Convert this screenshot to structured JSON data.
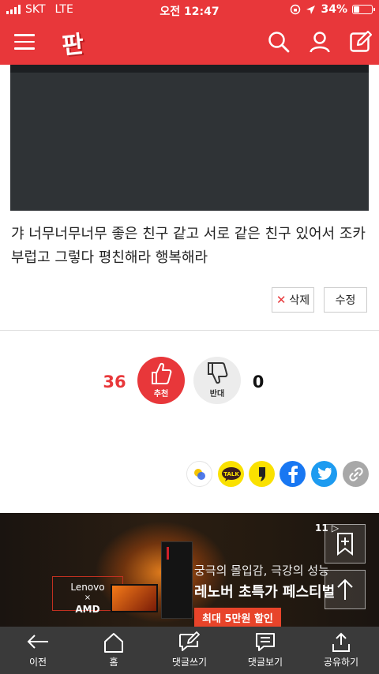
{
  "status_bar": {
    "carrier": "SKT",
    "network": "LTE",
    "time": "오전 12:47",
    "battery_text": "34%",
    "battery_level": 0.34
  },
  "header": {
    "logo_text": "판",
    "icons": [
      "menu-icon",
      "search-icon",
      "user-icon",
      "write-icon"
    ],
    "color": "#e8373a"
  },
  "comment": {
    "text": "갸 너무너무너무 좋은 친구 같고 서로 같은 친구 있어서 조카 부럽고 그렇다 평친해라 행복해라",
    "delete_label": "삭제",
    "edit_label": "수정"
  },
  "votes": {
    "up_count": "36",
    "up_label": "추천",
    "down_label": "반대",
    "down_count": "0"
  },
  "share_icons": [
    "kakaostory-icon",
    "kakaotalk-icon",
    "kakaopage-icon",
    "facebook-icon",
    "twitter-icon",
    "link-icon"
  ],
  "share": {
    "talk_label": "TALK"
  },
  "ad": {
    "counter": "11",
    "brand_line1": "Lenovo",
    "brand_line2": "×",
    "brand_line3": "AMD",
    "line1": "궁극의 몰입감, 극강의 성능",
    "line2": "레노버 초특가 페스티벌",
    "badge": "최대 5만원 할인"
  },
  "bottom_nav": [
    {
      "label": "이전",
      "icon": "back-arrow-icon"
    },
    {
      "label": "홈",
      "icon": "home-icon"
    },
    {
      "label": "댓글쓰기",
      "icon": "comment-write-icon"
    },
    {
      "label": "댓글보기",
      "icon": "comment-view-icon"
    },
    {
      "label": "공유하기",
      "icon": "share-icon"
    }
  ]
}
